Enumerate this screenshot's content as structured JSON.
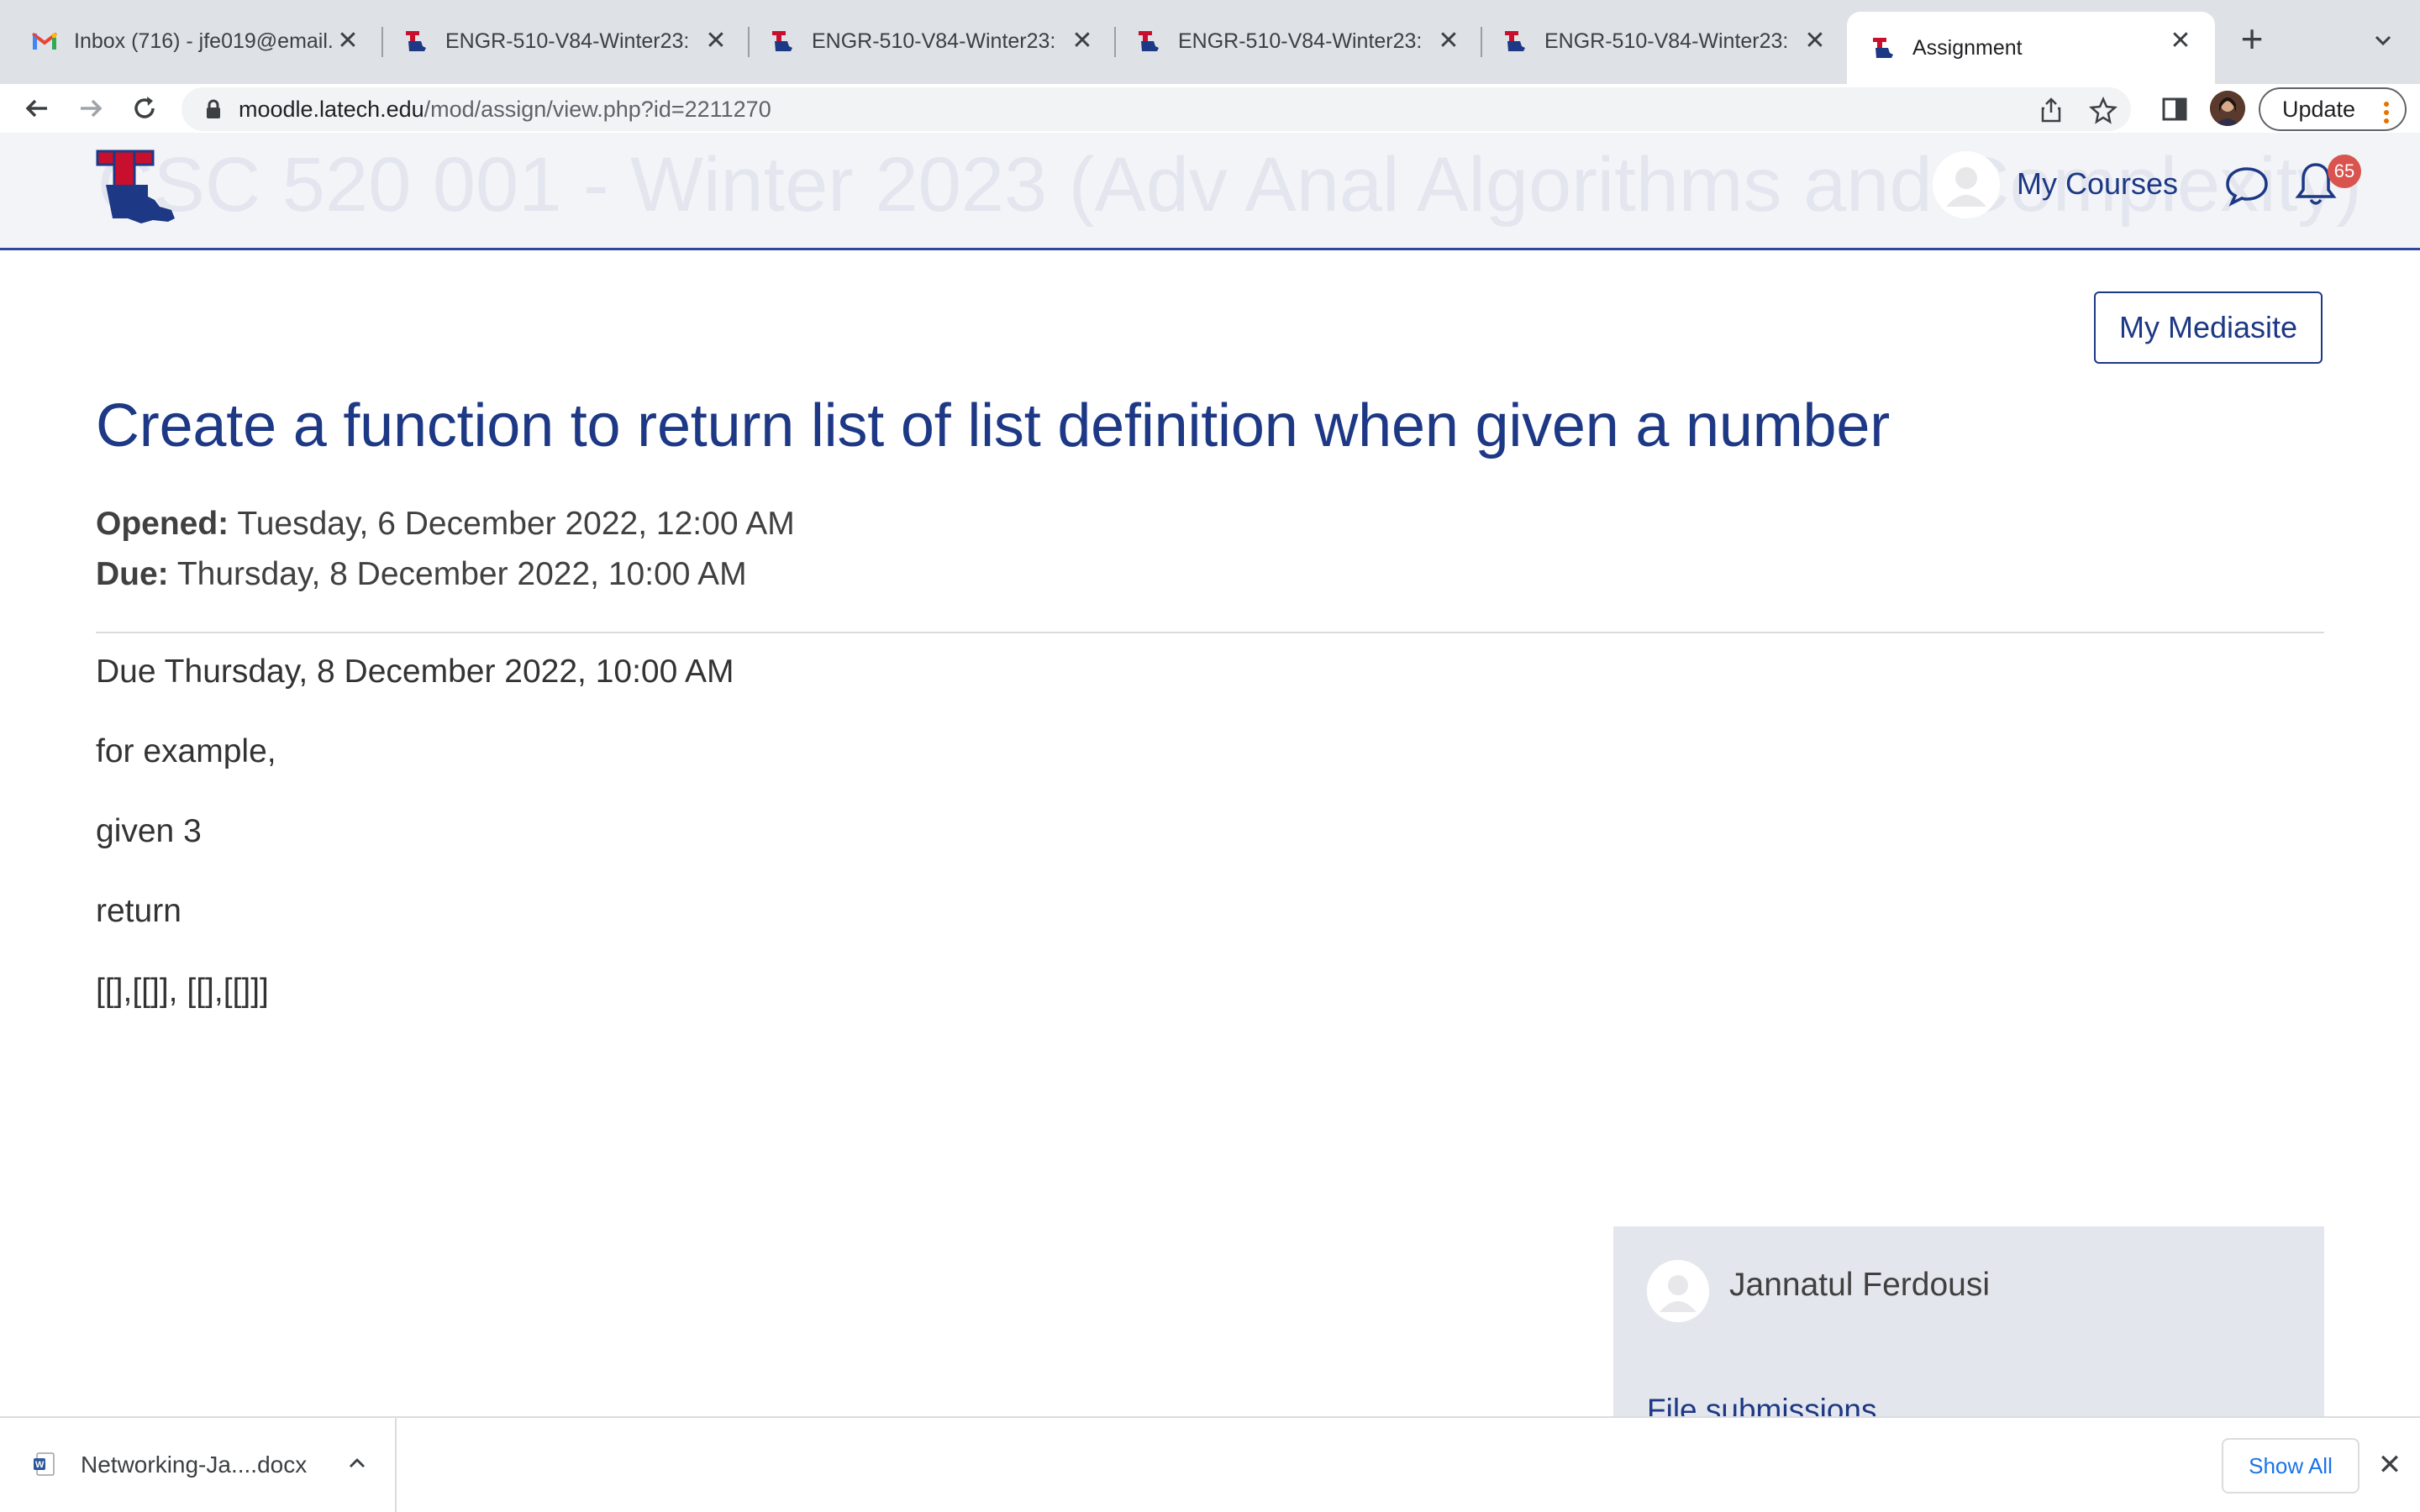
{
  "browser": {
    "tabs": [
      {
        "title": "Inbox (716) - jfe019@email.",
        "favicon": "gmail-icon",
        "active": false
      },
      {
        "title": "ENGR-510-V84-Winter23:",
        "favicon": "latech-icon",
        "active": false
      },
      {
        "title": "ENGR-510-V84-Winter23:",
        "favicon": "latech-icon",
        "active": false
      },
      {
        "title": "ENGR-510-V84-Winter23:",
        "favicon": "latech-icon",
        "active": false
      },
      {
        "title": "ENGR-510-V84-Winter23:",
        "favicon": "latech-icon",
        "active": false
      },
      {
        "title": "Assignment",
        "favicon": "latech-icon",
        "active": true
      }
    ],
    "url_host": "moodle.latech.edu",
    "url_path": "/mod/assign/view.php?id=2211270",
    "update_label": "Update"
  },
  "header": {
    "course_title": "CSC 520 001 - Winter 2023 (Adv Anal Algorithms and Complexity)",
    "my_courses_label": "My Courses",
    "notification_count": "65"
  },
  "main": {
    "mediasite_label": "My Mediasite",
    "title": "Create a function to return list of list definition when given a number",
    "opened_label": "Opened:",
    "opened_value": "Tuesday, 6 December 2022, 12:00 AM",
    "due_label": "Due:",
    "due_value": "Thursday, 8 December 2022, 10:00 AM",
    "description": [
      "Due Thursday, 8 December 2022, 10:00 AM",
      "for example,",
      "given 3",
      "return",
      "[[],[[]], [[],[[]]]"
    ]
  },
  "submission": {
    "user_name": "Jannatul Ferdousi",
    "file_submissions_label": "File submissions"
  },
  "downloads": {
    "file_name": "Networking-Ja....docx",
    "show_all_label": "Show All"
  },
  "colors": {
    "brand_blue": "#1d3885",
    "badge_red": "#d9534f",
    "tabstrip_bg": "#dee1e6"
  }
}
